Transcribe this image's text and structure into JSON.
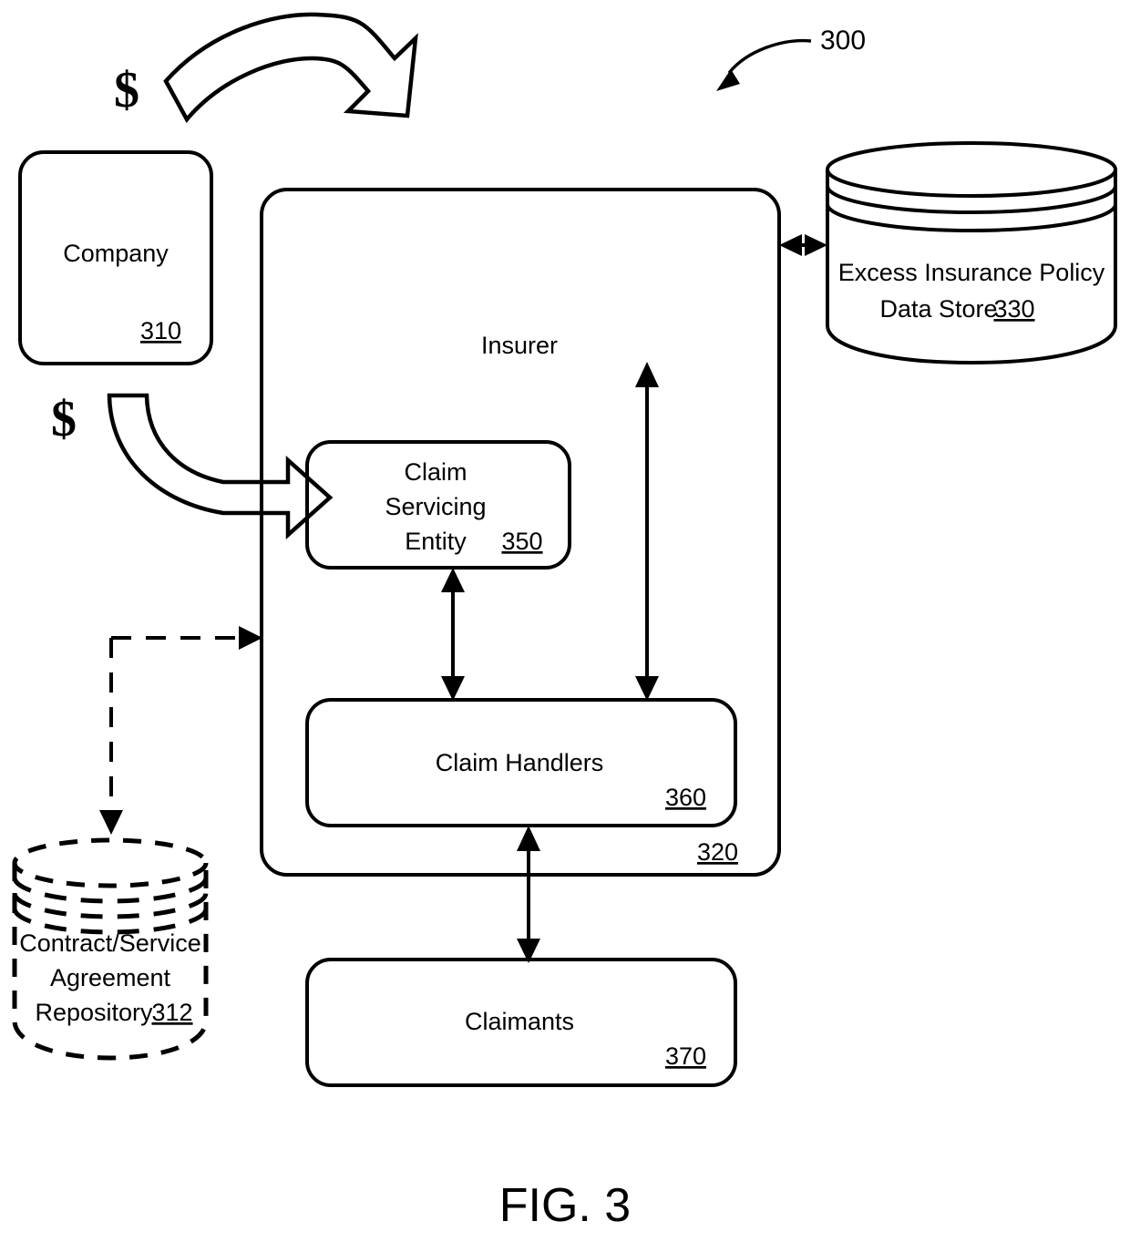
{
  "figure": {
    "caption": "FIG. 3",
    "reference_numeral": "300"
  },
  "nodes": {
    "company": {
      "label": "Company",
      "ref": "310",
      "shape": "rounded-rectangle"
    },
    "insurer": {
      "label": "Insurer",
      "ref": "320",
      "shape": "rounded-rectangle"
    },
    "excess_policy_store": {
      "label_line1": "Excess Insurance Policy",
      "label_line2": "Data Store",
      "ref": "330",
      "shape": "cylinder"
    },
    "claim_servicing_entity": {
      "label_line1": "Claim",
      "label_line2": "Servicing",
      "label_line3": "Entity",
      "ref": "350",
      "shape": "rounded-rectangle"
    },
    "claim_handlers": {
      "label": "Claim Handlers",
      "ref": "360",
      "shape": "rounded-rectangle"
    },
    "claimants": {
      "label": "Claimants",
      "ref": "370",
      "shape": "rounded-rectangle"
    },
    "contract_service_repository": {
      "label_line1": "Contract/Service",
      "label_line2": "Agreement",
      "label_line3": "Repository",
      "ref": "312",
      "shape": "dashed-cylinder"
    }
  },
  "annotations": {
    "money_symbol_top": "$",
    "money_symbol_bottom": "$"
  },
  "connectors": [
    {
      "name": "company-premium-to-insurer",
      "style": "block-arrow-arched",
      "direction": "one-way",
      "from": "company",
      "to": "insurer",
      "marker": "$"
    },
    {
      "name": "company-payment-to-claim-servicing-entity",
      "style": "block-arrow-curved",
      "direction": "one-way",
      "from": "company",
      "to": "claim_servicing_entity",
      "marker": "$"
    },
    {
      "name": "insurer-to-excess-policy-store",
      "style": "solid",
      "direction": "bidirectional",
      "from": "insurer",
      "to": "excess_policy_store"
    },
    {
      "name": "claim-servicing-entity-to-claim-handlers",
      "style": "solid",
      "direction": "bidirectional",
      "from": "claim_servicing_entity",
      "to": "claim_handlers"
    },
    {
      "name": "insurer-to-claim-handlers",
      "style": "solid",
      "direction": "bidirectional",
      "from": "insurer",
      "to": "claim_handlers"
    },
    {
      "name": "claim-handlers-to-claimants",
      "style": "solid",
      "direction": "bidirectional",
      "from": "claim_handlers",
      "to": "claimants"
    },
    {
      "name": "insurer-to-contract-service-repository",
      "style": "dashed",
      "direction": "bidirectional",
      "from": "insurer",
      "to": "contract_service_repository"
    }
  ],
  "colors": {
    "stroke": "#000000",
    "background": "#ffffff"
  }
}
